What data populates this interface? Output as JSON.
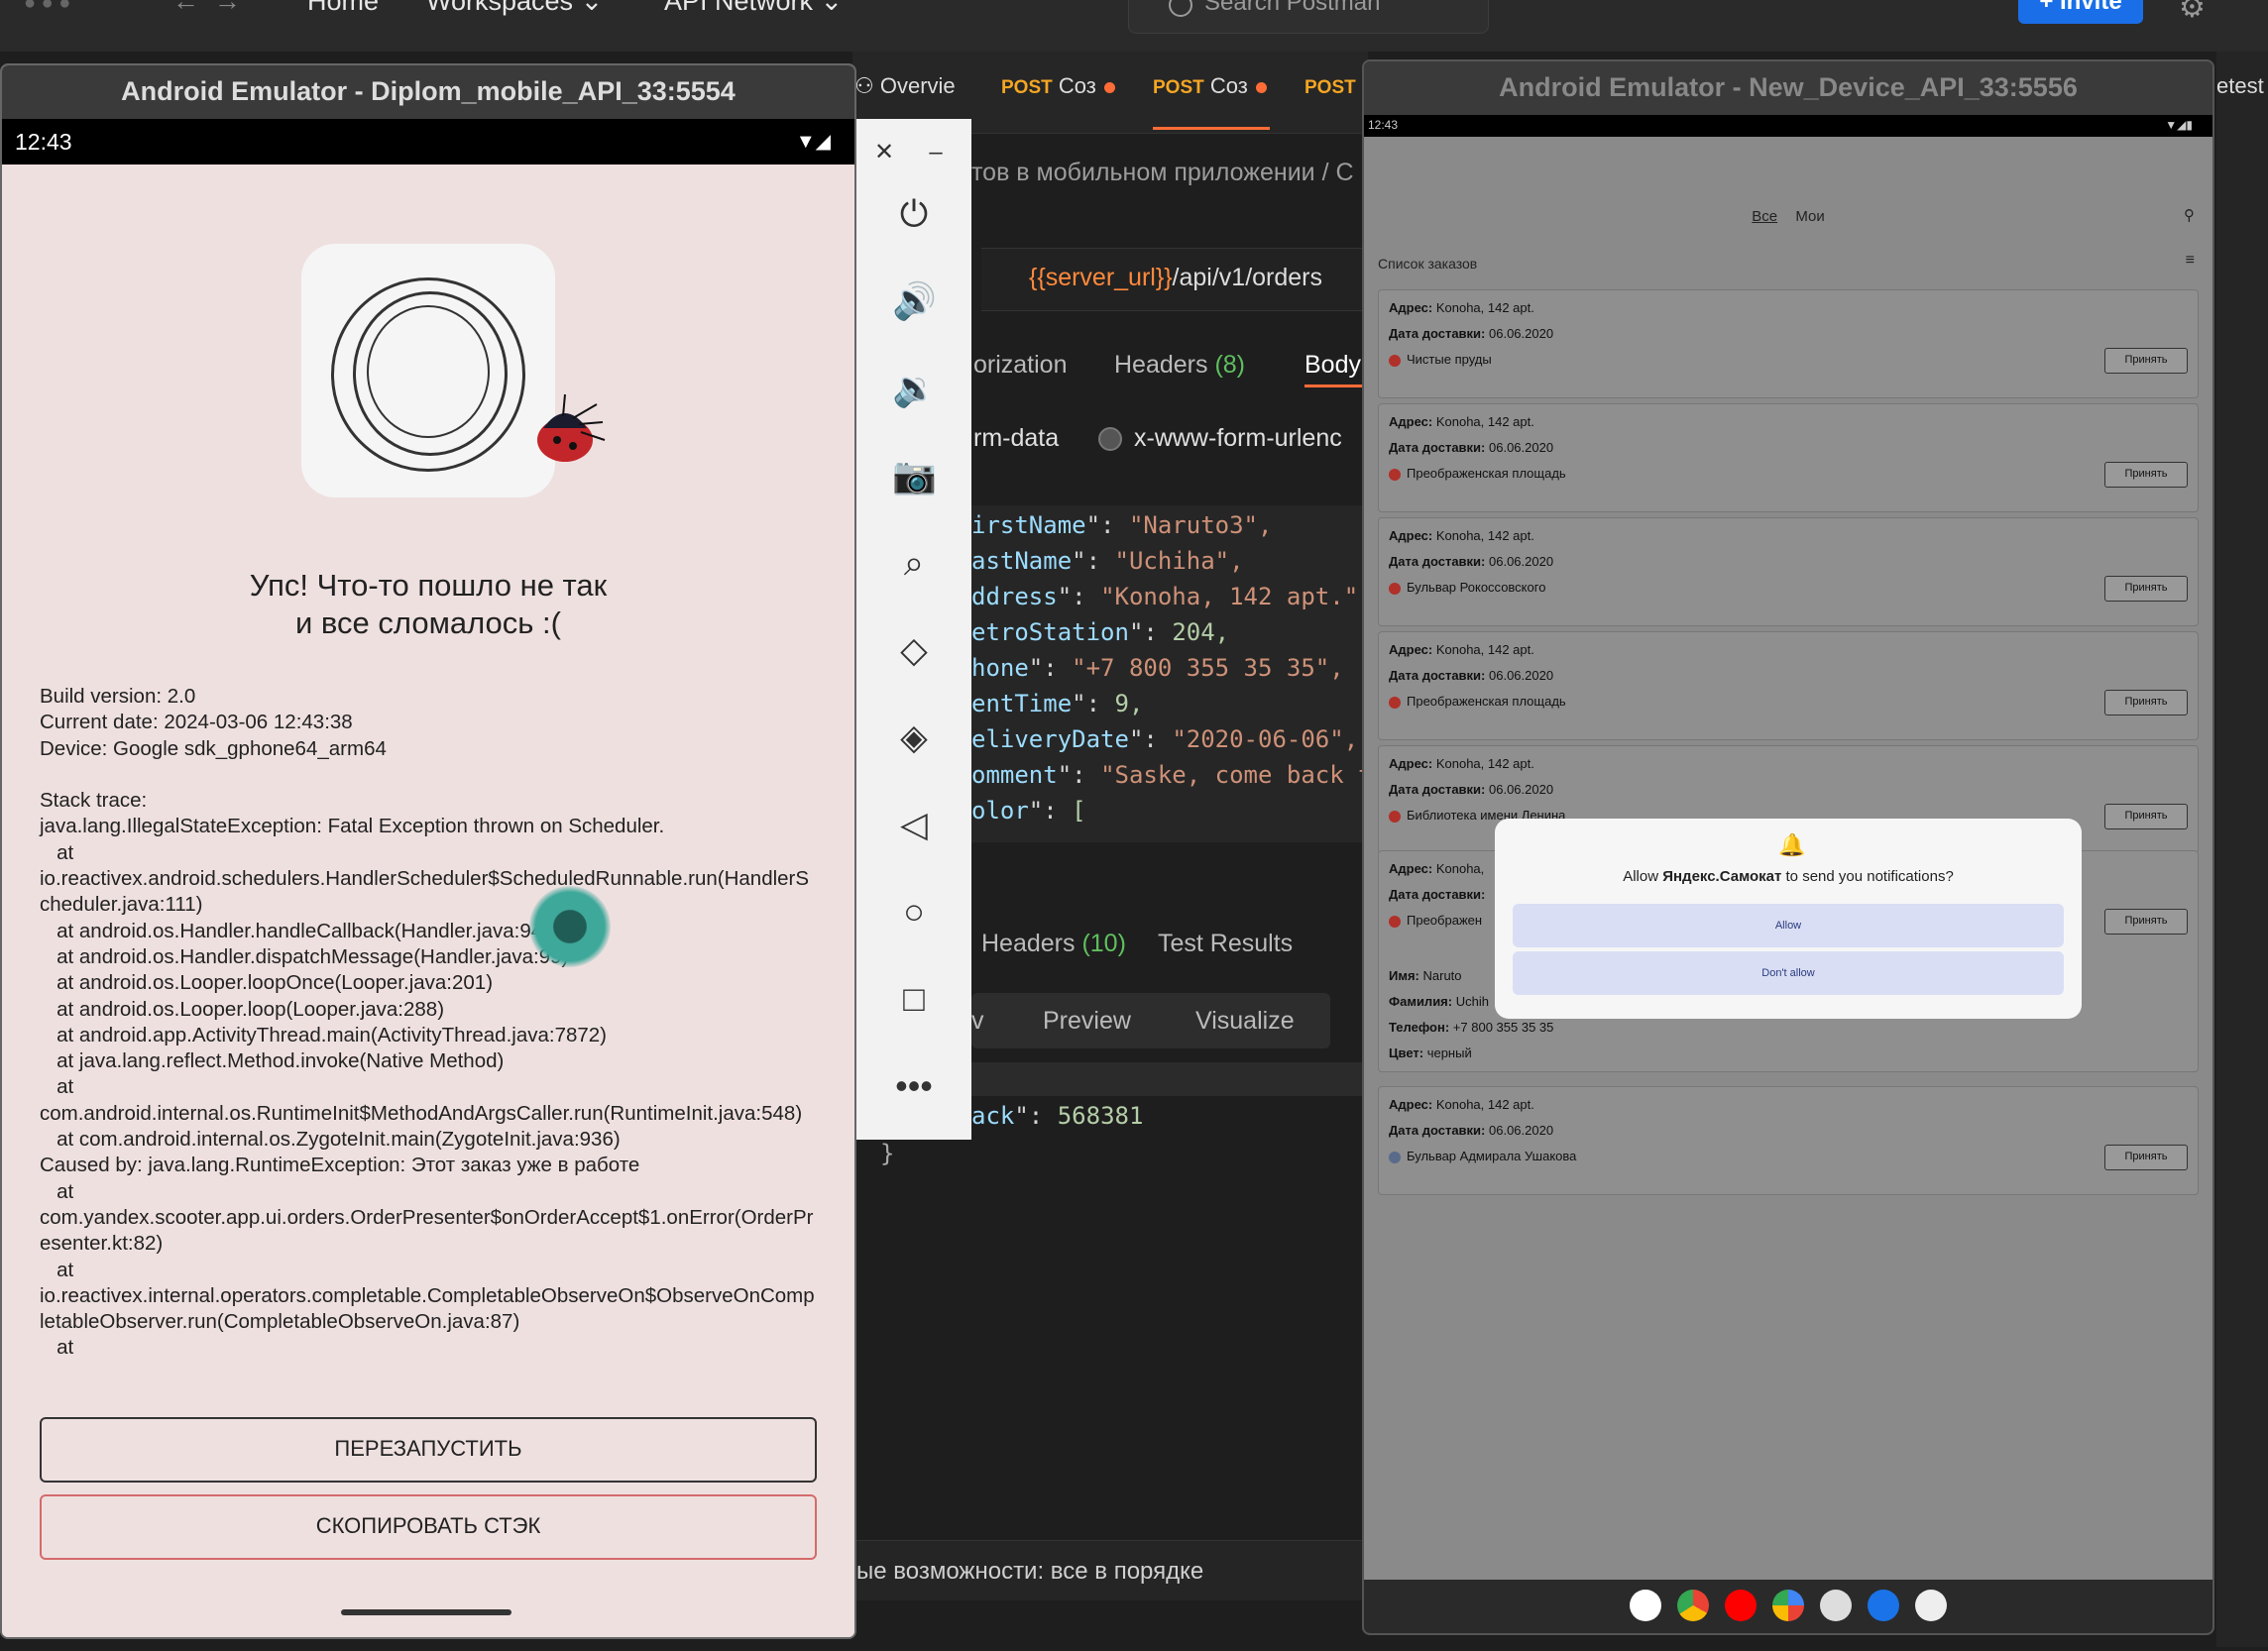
{
  "postman": {
    "nav": {
      "home": "Home",
      "workspaces": "Workspaces",
      "api_network": "API Network"
    },
    "search_placeholder": "Search Postman",
    "invite": "Invite",
    "tabs": [
      {
        "method": "",
        "label": "Overvie"
      },
      {
        "method": "POST",
        "label": "Соз"
      },
      {
        "method": "POST",
        "label": "Соз"
      },
      {
        "method": "POST",
        "label": ""
      }
    ],
    "right_tab": "etest",
    "breadcrumb": "тов в мобильном приложении  /  С",
    "url_var": "{{server_url}}",
    "url_path": "/api/v1/orders",
    "subtabs": {
      "authorization": "orization",
      "headers": "Headers",
      "headers_count": "(8)",
      "body": "Body"
    },
    "body_types": {
      "form_data": "rm-data",
      "urlencoded": "x-www-form-urlenc"
    },
    "code": [
      {
        "k": "irstName",
        "v": "\"Naruto3\","
      },
      {
        "k": "astName",
        "v": "\"Uchiha\","
      },
      {
        "k": "ddress",
        "v": "\"Konoha, 142 apt.\","
      },
      {
        "k": "etroStation",
        "v": "204,"
      },
      {
        "k": "hone",
        "v": "\"+7 800 355 35 35\","
      },
      {
        "k": "entTime",
        "v": "9,"
      },
      {
        "k": "eliveryDate",
        "v": "\"2020-06-06\","
      },
      {
        "k": "omment",
        "v": "\"Saske, come back t"
      },
      {
        "k": "olor",
        "v": "["
      }
    ],
    "response_tabs": {
      "headers": "Headers",
      "headers_count": "(10)",
      "tests": "Test Results"
    },
    "preview_tabs": {
      "raw": "v",
      "preview": "Preview",
      "visualize": "Visualize"
    },
    "response_line": {
      "k": "ack",
      "v": "568381"
    },
    "closing_brace": "}",
    "status": "ые возможности: все в порядке"
  },
  "emulator1": {
    "title": "Android Emulator - Diplom_mobile_API_33:5554",
    "time": "12:43",
    "error_title_line1": "Упс! Что-то пошло не так",
    "error_title_line2": "и все сломалось :(",
    "log": "Build version: 2.0\nCurrent date: 2024-03-06 12:43:38\nDevice: Google sdk_gphone64_arm64\n\nStack trace:\njava.lang.IllegalStateException: Fatal Exception thrown on Scheduler.\n   at\nio.reactivex.android.schedulers.HandlerScheduler$ScheduledRunnable.run(HandlerScheduler.java:111)\n   at android.os.Handler.handleCallback(Handler.java:942)\n   at android.os.Handler.dispatchMessage(Handler.java:99)\n   at android.os.Looper.loopOnce(Looper.java:201)\n   at android.os.Looper.loop(Looper.java:288)\n   at android.app.ActivityThread.main(ActivityThread.java:7872)\n   at java.lang.reflect.Method.invoke(Native Method)\n   at\ncom.android.internal.os.RuntimeInit$MethodAndArgsCaller.run(RuntimeInit.java:548)\n   at com.android.internal.os.ZygoteInit.main(ZygoteInit.java:936)\nCaused by: java.lang.RuntimeException: Этот заказ уже в работе\n   at\ncom.yandex.scooter.app.ui.orders.OrderPresenter$onOrderAccept$1.onError(OrderPresenter.kt:82)\n   at\nio.reactivex.internal.operators.completable.CompletableObserveOn$ObserveOnCompletableObserver.run(CompletableObserveOn.java:87)\n   at",
    "restart_button": "ПЕРЕЗАПУСТИТЬ",
    "copy_button": "СКОПИРОВАТЬ СТЭК"
  },
  "emulator2": {
    "title": "Android Emulator - New_Device_API_33:5556",
    "time": "12:43",
    "tab_all": "Все",
    "tab_mine": "Мои",
    "list_title": "Список заказов",
    "address_label": "Адрес:",
    "date_label": "Дата доставки:",
    "accept": "Принять",
    "orders": [
      {
        "address": "Konoha, 142 apt.",
        "date": "06.06.2020",
        "station": "Чистые пруды",
        "color": "#b0302a"
      },
      {
        "address": "Konoha, 142 apt.",
        "date": "06.06.2020",
        "station": "Преображенская площадь",
        "color": "#b0302a"
      },
      {
        "address": "Konoha, 142 apt.",
        "date": "06.06.2020",
        "station": "Бульвар Рокоссовского",
        "color": "#b0302a"
      },
      {
        "address": "Konoha, 142 apt.",
        "date": "06.06.2020",
        "station": "Преображенская площадь",
        "color": "#b0302a"
      },
      {
        "address": "Konoha, 142 apt.",
        "date": "06.06.2020",
        "station": "Библиотека имени Ленина",
        "color": "#b0302a"
      }
    ],
    "expanded": {
      "address": "Konoha,",
      "date_label": "Дата доставки:",
      "station": "Преображен",
      "name_label": "Имя:",
      "name": "Naruto",
      "surname_label": "Фамилия:",
      "surname": "Uchih",
      "phone_label": "Телефон:",
      "phone": "+7 800 355 35 35",
      "color_label": "Цвет:",
      "color": "черный"
    },
    "last_order": {
      "address": "Konoha, 142 apt.",
      "date": "06.06.2020",
      "station": "Бульвар Адмирала Ушакова",
      "color": "#5a6a8a"
    },
    "dialog": {
      "text_prefix": "Allow ",
      "app_name": "Яндекс.Самокат",
      "text_suffix": " to send you notifications?",
      "allow": "Allow",
      "deny": "Don't allow"
    }
  },
  "colors": {
    "postman_accent": "#ff6c37",
    "invite": "#1a6fe8",
    "code_key": "#9cdcfe",
    "code_string": "#ce9178"
  }
}
